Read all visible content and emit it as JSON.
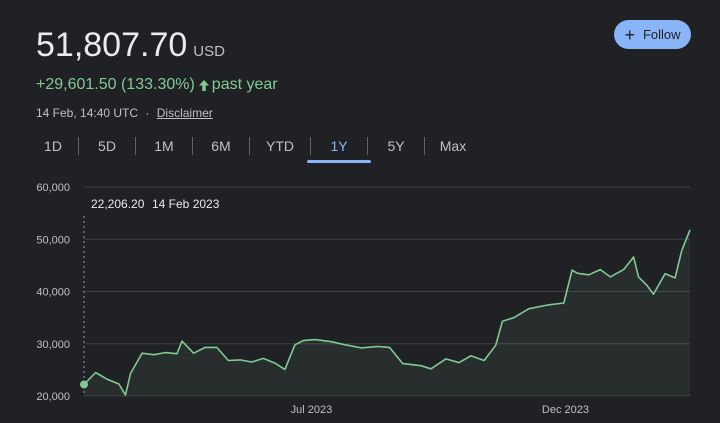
{
  "quote": {
    "price": "51,807.70",
    "currency": "USD",
    "change": "+29,601.50 (133.30%)",
    "change_arrow": "arrow-up-icon",
    "period": "past year",
    "timestamp": "14 Feb, 14:40 UTC",
    "separator": "·",
    "disclaimer": "Disclaimer"
  },
  "follow_button": {
    "label": "Follow",
    "icon": "plus-icon"
  },
  "tabs": [
    "1D",
    "5D",
    "1M",
    "6M",
    "YTD",
    "1Y",
    "5Y",
    "Max"
  ],
  "active_tab": "1Y",
  "colors": {
    "line": "#81c995",
    "accent": "#8ab4f8",
    "background": "#202124",
    "grid": "#3c4043"
  },
  "chart_data": {
    "type": "line",
    "ylim": [
      20000,
      60000
    ],
    "yticks": [
      60000,
      50000,
      40000,
      30000,
      20000
    ],
    "ytick_labels": [
      "60,000",
      "50,000",
      "40,000",
      "30,000",
      "20,000"
    ],
    "xtick_labels": [
      "Jul 2023",
      "Dec 2023"
    ],
    "xtick_dates": [
      "2023-07-01",
      "2023-12-01"
    ],
    "xrange": [
      "2023-02-14",
      "2024-02-14"
    ],
    "hover": {
      "value": "22,206.20",
      "date": "14 Feb 2023"
    },
    "series": [
      {
        "x": [
          "2023-02-14",
          "2023-02-21",
          "2023-02-28",
          "2023-03-07",
          "2023-03-11",
          "2023-03-14",
          "2023-03-21",
          "2023-03-28",
          "2023-04-04",
          "2023-04-11",
          "2023-04-14",
          "2023-04-21",
          "2023-04-28",
          "2023-05-05",
          "2023-05-12",
          "2023-05-19",
          "2023-05-26",
          "2023-06-02",
          "2023-06-09",
          "2023-06-15",
          "2023-06-21",
          "2023-06-26",
          "2023-07-03",
          "2023-07-13",
          "2023-07-20",
          "2023-07-31",
          "2023-08-10",
          "2023-08-17",
          "2023-08-25",
          "2023-09-05",
          "2023-09-11",
          "2023-09-20",
          "2023-09-28",
          "2023-10-05",
          "2023-10-13",
          "2023-10-20",
          "2023-10-24",
          "2023-10-31",
          "2023-11-09",
          "2023-11-20",
          "2023-11-30",
          "2023-12-05",
          "2023-12-08",
          "2023-12-15",
          "2023-12-22",
          "2023-12-28",
          "2024-01-05",
          "2024-01-11",
          "2024-01-14",
          "2024-01-19",
          "2024-01-23",
          "2024-01-30",
          "2024-02-05",
          "2024-02-09",
          "2024-02-14"
        ],
        "y": [
          22206,
          24500,
          23200,
          22300,
          20200,
          24300,
          28200,
          27900,
          28300,
          28100,
          30500,
          28200,
          29300,
          29300,
          26800,
          26900,
          26500,
          27200,
          26300,
          25100,
          29800,
          30600,
          30800,
          30400,
          29900,
          29200,
          29500,
          29300,
          26200,
          25800,
          25200,
          27100,
          26400,
          27700,
          26800,
          29700,
          34300,
          35000,
          36700,
          37400,
          37800,
          44100,
          43500,
          43200,
          44200,
          42800,
          44200,
          46600,
          42800,
          41200,
          39500,
          43400,
          42600,
          47800,
          51807
        ]
      }
    ]
  }
}
